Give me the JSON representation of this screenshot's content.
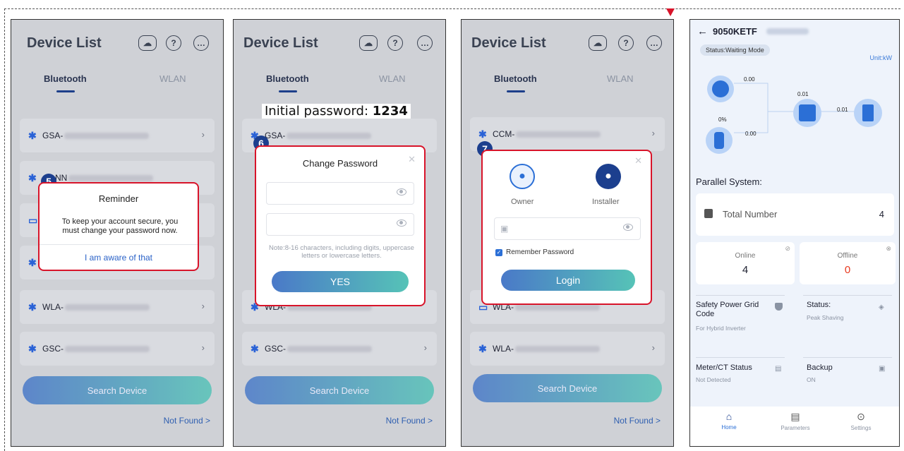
{
  "shared": {
    "title": "Device List",
    "tab_bluetooth": "Bluetooth",
    "tab_wlan": "WLAN",
    "search": "Search Device",
    "not_found": "Not Found >"
  },
  "panel1": {
    "devices": [
      "GSA-",
      "NN",
      "",
      "",
      "WLA-",
      "GSC-"
    ],
    "badge": "5",
    "reminder_title": "Reminder",
    "reminder_text": "To keep your account secure, you must change your password now.",
    "reminder_action": "I am aware of that"
  },
  "panel2": {
    "overlay_label": "Initial password: ",
    "overlay_value": "1234",
    "devices": [
      "GSA-",
      "WLA-",
      "GSC-"
    ],
    "badge": "6",
    "dialog_title": "Change Password",
    "note": "Note:8-16 characters, including digits, uppercase letters or lowercase letters.",
    "confirm": "YES"
  },
  "panel3": {
    "devices": [
      "CCM-",
      "WLA-",
      "WLA-"
    ],
    "badge": "7",
    "owner": "Owner",
    "installer": "Installer",
    "remember": "Remember Password",
    "login": "Login"
  },
  "panel4": {
    "title": "9050KETF",
    "status": "Status:Waiting Mode",
    "unit": "Unit:kW",
    "pv_value": "0.00",
    "home_value": "0.01",
    "grid_value": "0.01",
    "battery_pct": "0%",
    "battery_value": "0.00",
    "parallel_title": "Parallel System:",
    "total_label": "Total Number",
    "total_value": "4",
    "online_label": "Online",
    "online_value": "4",
    "offline_label": "Offline",
    "offline_value": "0",
    "safety_title": "Safety Power Grid Code",
    "safety_sub": "For Hybrid Inverter",
    "status_title": "Status:",
    "status_sub": "Peak Shaving",
    "meter_title": "Meter/CT Status",
    "meter_sub": "Not Detected",
    "backup_title": "Backup",
    "backup_sub": "ON",
    "nav": [
      "Home",
      "Parameters",
      "Settings"
    ]
  },
  "colors": {
    "accent_red": "#d8142a",
    "brand_blue": "#1c3f8e",
    "offline_red": "#e8391f"
  }
}
